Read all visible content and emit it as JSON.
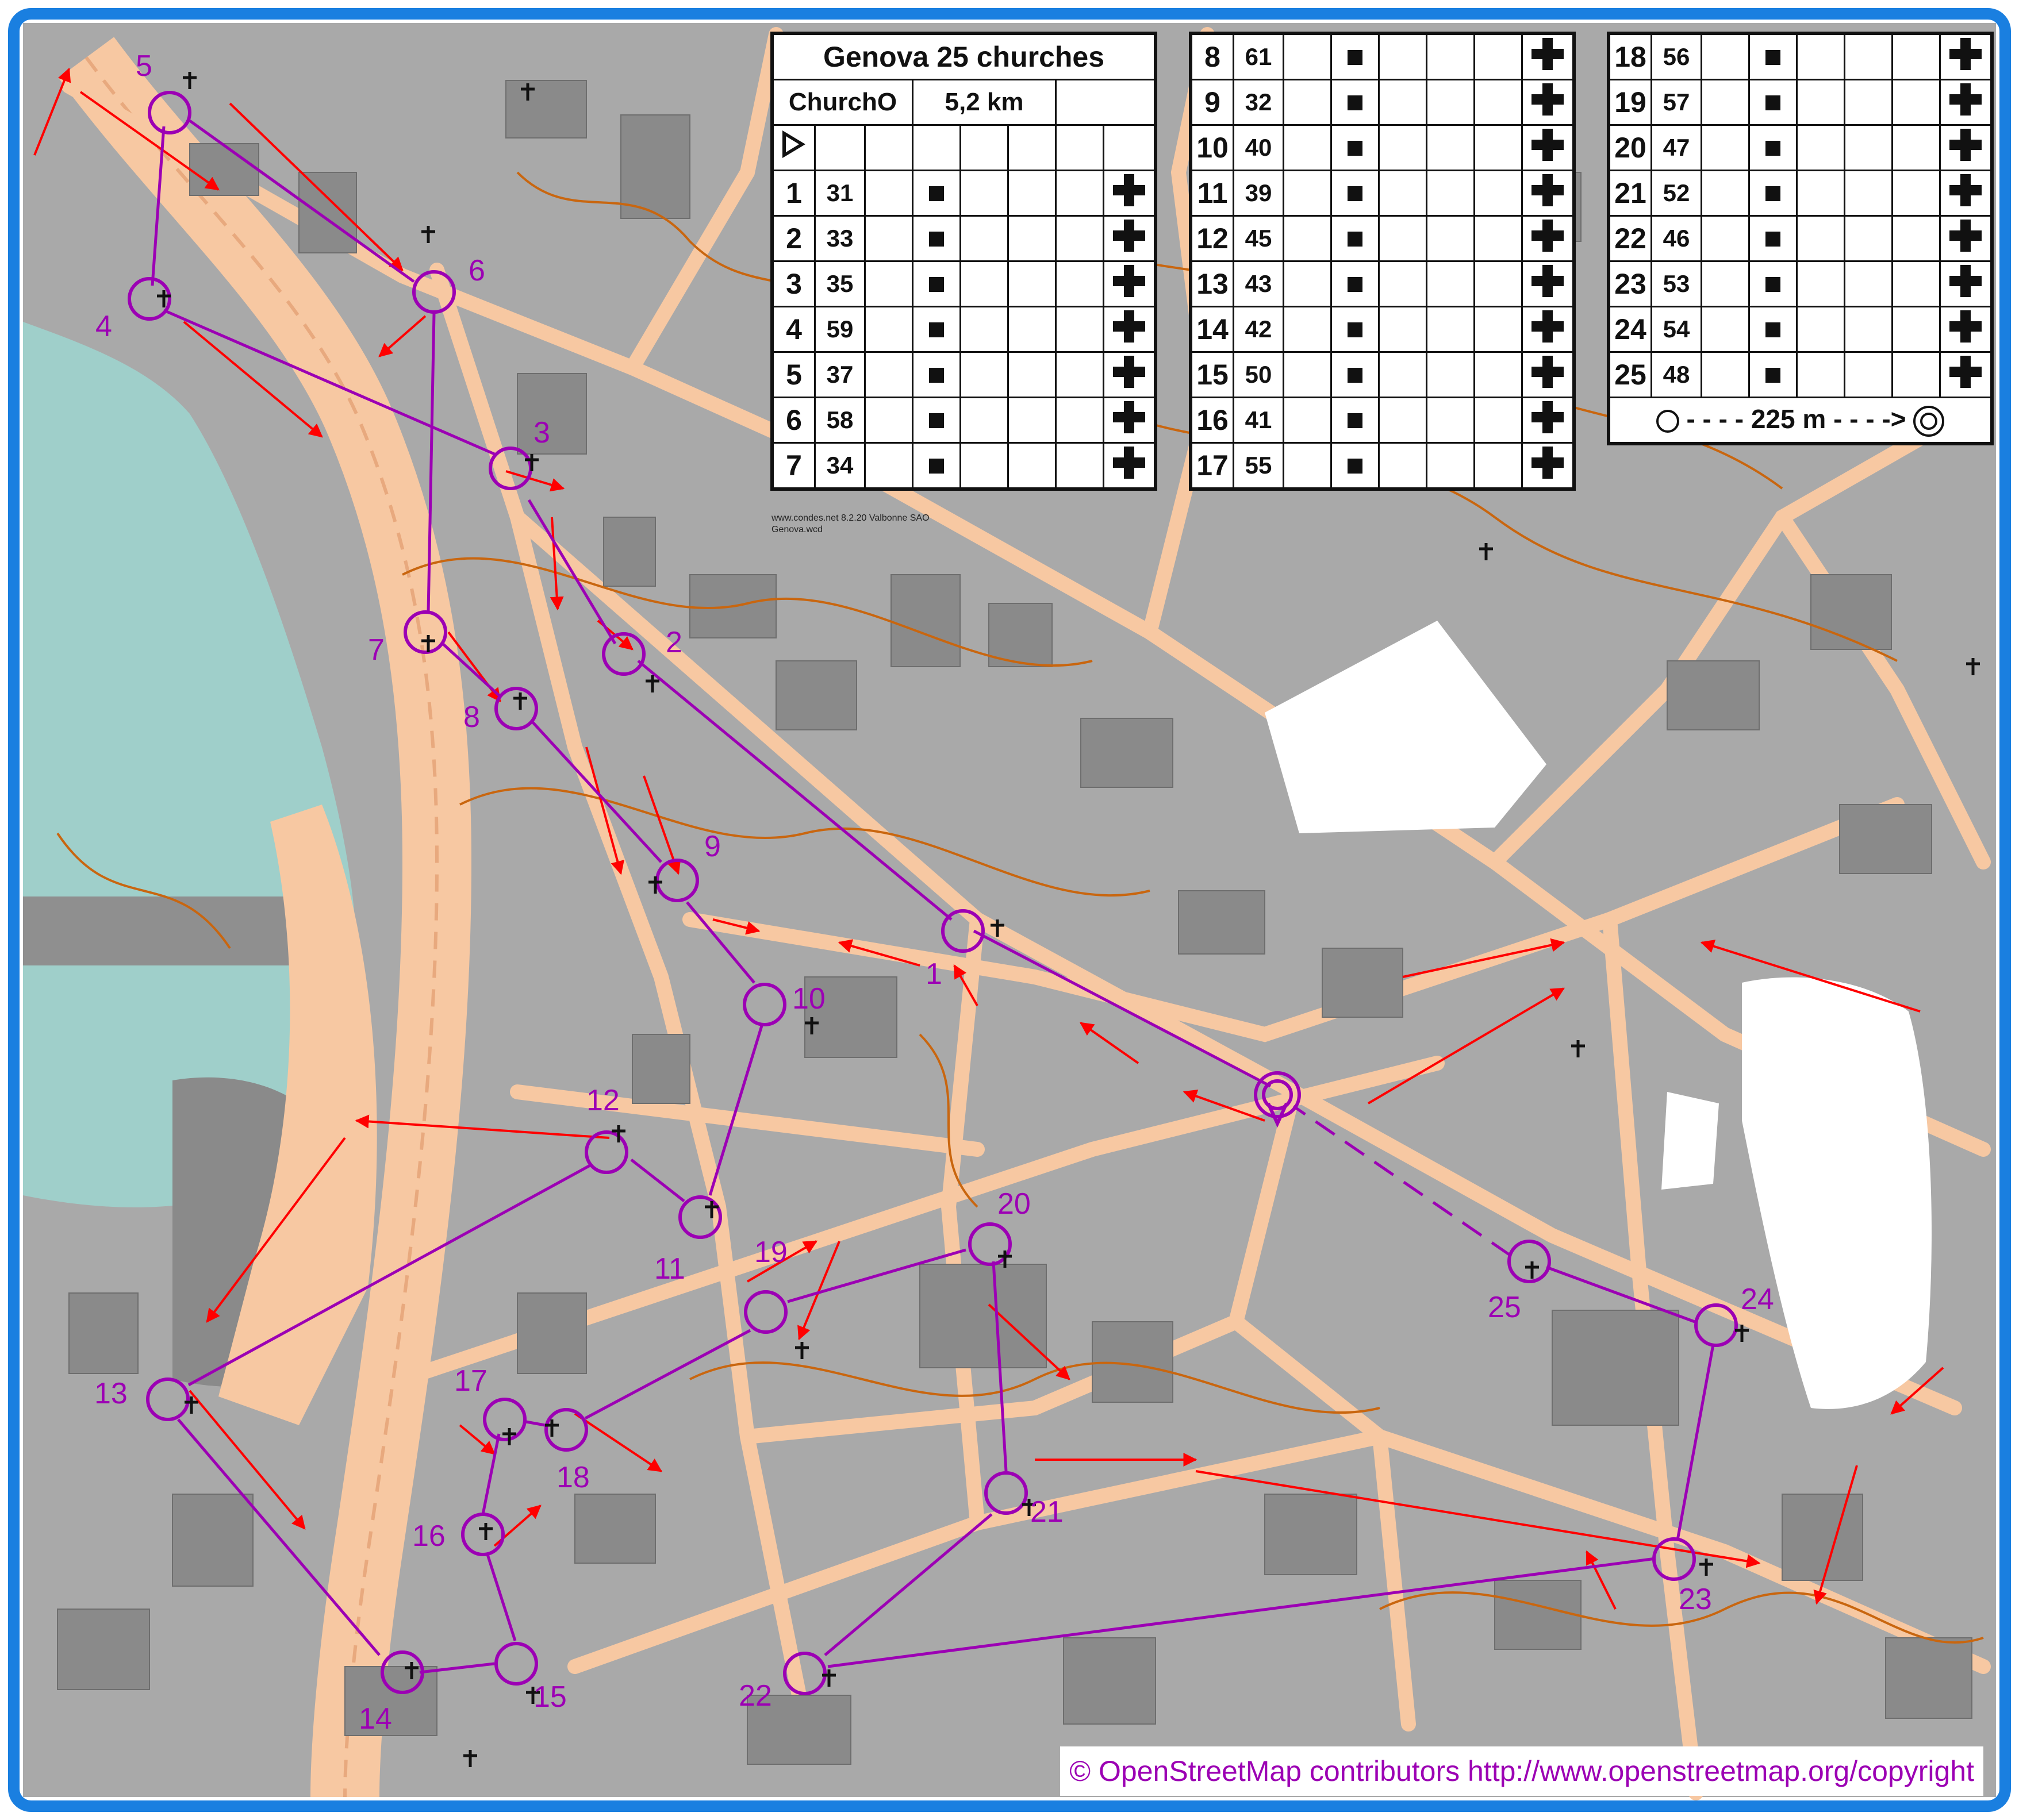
{
  "course": {
    "event": "Genova 25 churches",
    "class": "ChurchO",
    "length": "5,2 km",
    "control_icon": "cross-icon",
    "feature_icon": "square-icon",
    "start_icon": "start-triangle-icon",
    "controls_col1": [
      {
        "n": "1",
        "code": "31"
      },
      {
        "n": "2",
        "code": "33"
      },
      {
        "n": "3",
        "code": "35"
      },
      {
        "n": "4",
        "code": "59"
      },
      {
        "n": "5",
        "code": "37"
      },
      {
        "n": "6",
        "code": "58"
      },
      {
        "n": "7",
        "code": "34"
      }
    ],
    "controls_col2": [
      {
        "n": "8",
        "code": "61"
      },
      {
        "n": "9",
        "code": "32"
      },
      {
        "n": "10",
        "code": "40"
      },
      {
        "n": "11",
        "code": "39"
      },
      {
        "n": "12",
        "code": "45"
      },
      {
        "n": "13",
        "code": "43"
      },
      {
        "n": "14",
        "code": "42"
      },
      {
        "n": "15",
        "code": "50"
      },
      {
        "n": "16",
        "code": "41"
      },
      {
        "n": "17",
        "code": "55"
      }
    ],
    "controls_col3": [
      {
        "n": "18",
        "code": "56"
      },
      {
        "n": "19",
        "code": "57"
      },
      {
        "n": "20",
        "code": "47"
      },
      {
        "n": "21",
        "code": "52"
      },
      {
        "n": "22",
        "code": "46"
      },
      {
        "n": "23",
        "code": "53"
      },
      {
        "n": "24",
        "code": "54"
      },
      {
        "n": "25",
        "code": "48"
      }
    ],
    "finish_text": "225 m",
    "software_line1": "www.condes.net 8.2.20 Valbonne SAO",
    "software_line2": "Genova.wcd"
  },
  "map": {
    "attribution": "© OpenStreetMap contributors http://www.openstreetmap.org/copyright",
    "colors": {
      "background": "#a9a9a9",
      "paved": "#f7c8a2",
      "road_edge": "#e8a97e",
      "building": "#8a8a8a",
      "water": "#9fcfca",
      "contour": "#c9660f",
      "course": "#9c00b4",
      "route": "#ff0000",
      "frame": "#1a7fe0"
    },
    "controls": [
      {
        "label": "1"
      },
      {
        "label": "2"
      },
      {
        "label": "3"
      },
      {
        "label": "4"
      },
      {
        "label": "5"
      },
      {
        "label": "6"
      },
      {
        "label": "7"
      },
      {
        "label": "8"
      },
      {
        "label": "9"
      },
      {
        "label": "10"
      },
      {
        "label": "11"
      },
      {
        "label": "12"
      },
      {
        "label": "13"
      },
      {
        "label": "14"
      },
      {
        "label": "15"
      },
      {
        "label": "16"
      },
      {
        "label": "17"
      },
      {
        "label": "18"
      },
      {
        "label": "19"
      },
      {
        "label": "20"
      },
      {
        "label": "21"
      },
      {
        "label": "22"
      },
      {
        "label": "23"
      },
      {
        "label": "24"
      },
      {
        "label": "25"
      }
    ],
    "church_icon": "church-cross-icon"
  }
}
